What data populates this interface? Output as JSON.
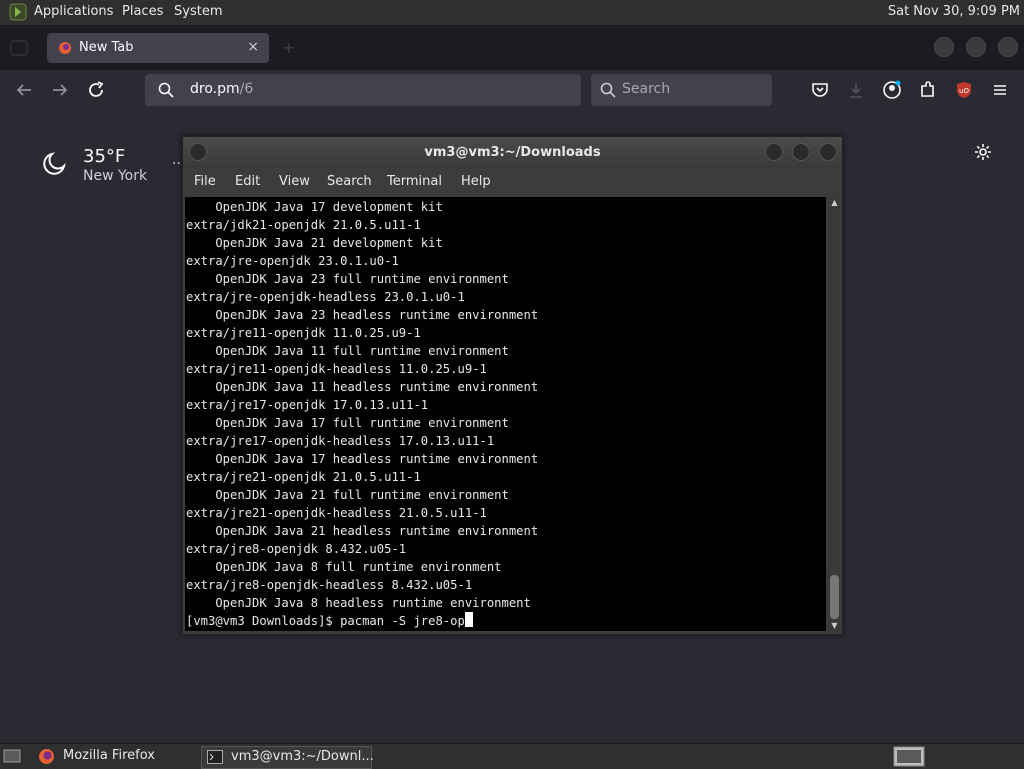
{
  "top_panel": {
    "menus": [
      "Applications",
      "Places",
      "System"
    ],
    "clock": "Sat Nov 30,  9:09 PM"
  },
  "browser": {
    "tab": {
      "title": "New Tab",
      "close_icon": "×"
    },
    "url": {
      "host": "dro.pm",
      "path": "/6"
    },
    "search": {
      "placeholder": "Search"
    },
    "extension_badge": "uO"
  },
  "newtab": {
    "weather": {
      "temp": "35°F",
      "location": "New York",
      "more": ".."
    }
  },
  "terminal": {
    "title": "vm3@vm3:~/Downloads",
    "menu": [
      "File",
      "Edit",
      "View",
      "Search",
      "Terminal",
      "Help"
    ],
    "lines": [
      "    OpenJDK Java 17 development kit",
      "extra/jdk21-openjdk 21.0.5.u11-1",
      "    OpenJDK Java 21 development kit",
      "extra/jre-openjdk 23.0.1.u0-1",
      "    OpenJDK Java 23 full runtime environment",
      "extra/jre-openjdk-headless 23.0.1.u0-1",
      "    OpenJDK Java 23 headless runtime environment",
      "extra/jre11-openjdk 11.0.25.u9-1",
      "    OpenJDK Java 11 full runtime environment",
      "extra/jre11-openjdk-headless 11.0.25.u9-1",
      "    OpenJDK Java 11 headless runtime environment",
      "extra/jre17-openjdk 17.0.13.u11-1",
      "    OpenJDK Java 17 full runtime environment",
      "extra/jre17-openjdk-headless 17.0.13.u11-1",
      "    OpenJDK Java 17 headless runtime environment",
      "extra/jre21-openjdk 21.0.5.u11-1",
      "    OpenJDK Java 21 full runtime environment",
      "extra/jre21-openjdk-headless 21.0.5.u11-1",
      "    OpenJDK Java 21 headless runtime environment",
      "extra/jre8-openjdk 8.432.u05-1",
      "    OpenJDK Java 8 full runtime environment",
      "extra/jre8-openjdk-headless 8.432.u05-1",
      "    OpenJDK Java 8 headless runtime environment"
    ],
    "prompt": "[vm3@vm3 Downloads]$ pacman -S jre8-op",
    "scroll_position": 0.97
  },
  "taskbar": {
    "tasks": [
      "Mozilla Firefox",
      "vm3@vm3:~/Downl..."
    ]
  },
  "colors": {
    "accent_ublock": "#c0392b",
    "terminal_bg": "#000000"
  }
}
